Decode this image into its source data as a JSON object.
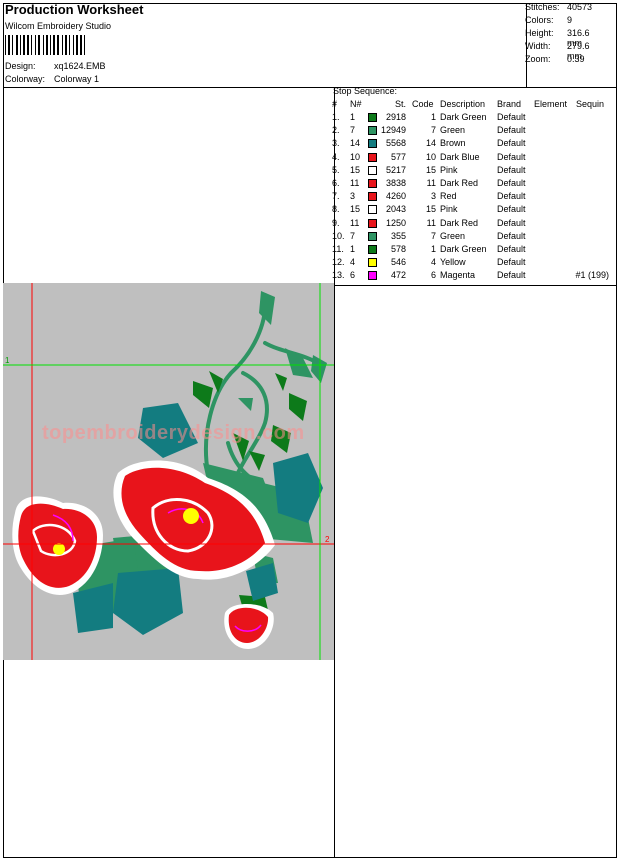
{
  "header": {
    "title": "Production Worksheet",
    "software": "Wilcom Embroidery Studio",
    "design_label": "Design:",
    "design_value": "xq1624.EMB",
    "colorway_label": "Colorway:",
    "colorway_value": "Colorway 1"
  },
  "stats": [
    {
      "label": "Stitches:",
      "value": "40573"
    },
    {
      "label": "Colors:",
      "value": "9"
    },
    {
      "label": "Height:",
      "value": "316.6 mm"
    },
    {
      "label": "Width:",
      "value": "279.6 mm"
    },
    {
      "label": "Zoom:",
      "value": "0.39"
    }
  ],
  "stop_sequence": {
    "title": "Stop Sequence:",
    "headers": {
      "num": "#",
      "n": "N#",
      "st": "St.",
      "code": "Code",
      "description": "Description",
      "brand": "Brand",
      "element": "Element",
      "sequin": "Sequin"
    },
    "rows": [
      {
        "num": "1.",
        "n": "1",
        "color": "#0d7a1a",
        "st": "2918",
        "code": "1",
        "description": "Dark Green",
        "brand": "Default",
        "element": "",
        "sequin": ""
      },
      {
        "num": "2.",
        "n": "7",
        "color": "#2e9463",
        "st": "12949",
        "code": "7",
        "description": "Green",
        "brand": "Default",
        "element": "",
        "sequin": ""
      },
      {
        "num": "3.",
        "n": "14",
        "color": "#137c80",
        "st": "5568",
        "code": "14",
        "description": "Brown",
        "brand": "Default",
        "element": "",
        "sequin": ""
      },
      {
        "num": "4.",
        "n": "10",
        "color": "#e8141b",
        "st": "577",
        "code": "10",
        "description": "Dark Blue",
        "brand": "Default",
        "element": "",
        "sequin": ""
      },
      {
        "num": "5.",
        "n": "15",
        "color": "#ffffff",
        "st": "5217",
        "code": "15",
        "description": "Pink",
        "brand": "Default",
        "element": "",
        "sequin": ""
      },
      {
        "num": "6.",
        "n": "11",
        "color": "#e8141b",
        "st": "3838",
        "code": "11",
        "description": "Dark Red",
        "brand": "Default",
        "element": "",
        "sequin": ""
      },
      {
        "num": "7.",
        "n": "3",
        "color": "#e8141b",
        "st": "4260",
        "code": "3",
        "description": "Red",
        "brand": "Default",
        "element": "",
        "sequin": ""
      },
      {
        "num": "8.",
        "n": "15",
        "color": "#ffffff",
        "st": "2043",
        "code": "15",
        "description": "Pink",
        "brand": "Default",
        "element": "",
        "sequin": ""
      },
      {
        "num": "9.",
        "n": "11",
        "color": "#e8141b",
        "st": "1250",
        "code": "11",
        "description": "Dark Red",
        "brand": "Default",
        "element": "",
        "sequin": ""
      },
      {
        "num": "10.",
        "n": "7",
        "color": "#2e9463",
        "st": "355",
        "code": "7",
        "description": "Green",
        "brand": "Default",
        "element": "",
        "sequin": ""
      },
      {
        "num": "11.",
        "n": "1",
        "color": "#0d7a1a",
        "st": "578",
        "code": "1",
        "description": "Dark Green",
        "brand": "Default",
        "element": "",
        "sequin": ""
      },
      {
        "num": "12.",
        "n": "4",
        "color": "#ffff00",
        "st": "546",
        "code": "4",
        "description": "Yellow",
        "brand": "Default",
        "element": "",
        "sequin": ""
      },
      {
        "num": "13.",
        "n": "6",
        "color": "#ff00ff",
        "st": "472",
        "code": "6",
        "description": "Magenta",
        "brand": "Default",
        "element": "",
        "sequin": "#1 (199)"
      }
    ]
  },
  "canvas": {
    "background": "#bfbfbf",
    "guide_labels": [
      "1",
      "2"
    ],
    "watermark": "topembroiderydesign.com"
  }
}
